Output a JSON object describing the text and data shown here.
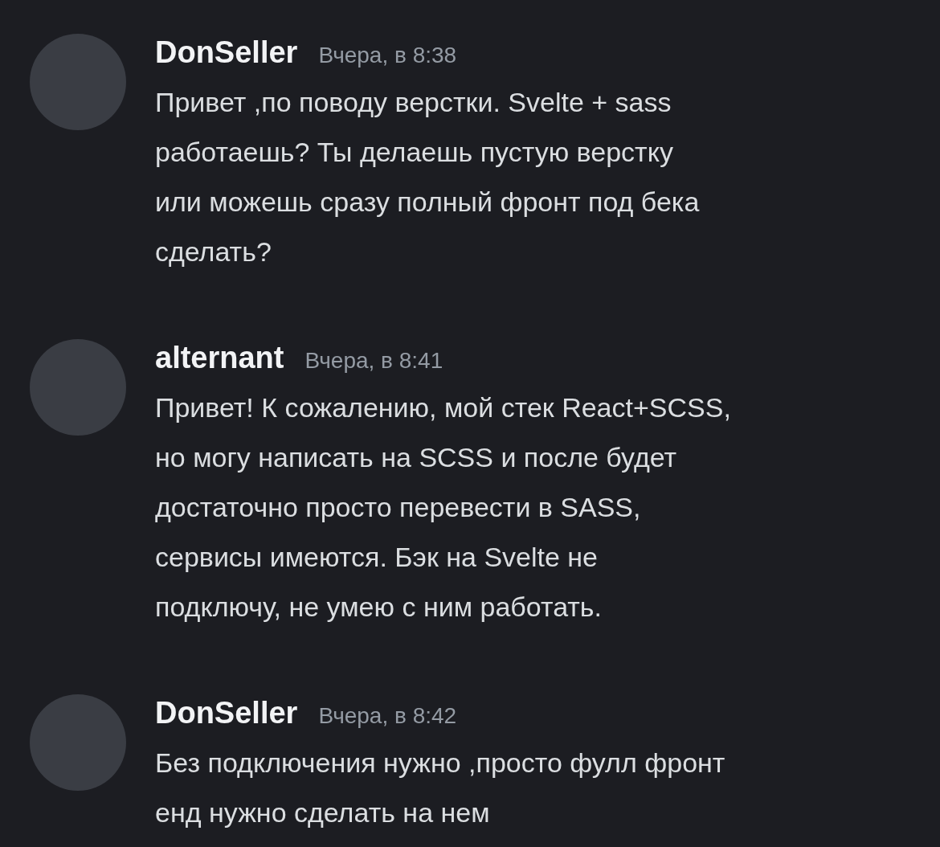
{
  "messages": [
    {
      "author": "DonSeller",
      "time": "Вчера, в 8:38",
      "text": "Привет ,по поводу верстки. Svelte + sass\nработаешь? Ты делаешь пустую верстку\nили можешь сразу полный фронт под бека\nсделать?"
    },
    {
      "author": "alternant",
      "time": "Вчера, в 8:41",
      "text": "Привет! К сожалению, мой стек React+SCSS,\nно могу написать на SCSS и после будет\nдостаточно просто перевести в SASS,\nсервисы имеются. Бэк на Svelte не\nподключу, не умею с ним работать."
    },
    {
      "author": "DonSeller",
      "time": "Вчера, в 8:42",
      "text": "Без подключения нужно ,просто фулл фронт\nенд нужно сделать на нем"
    }
  ]
}
